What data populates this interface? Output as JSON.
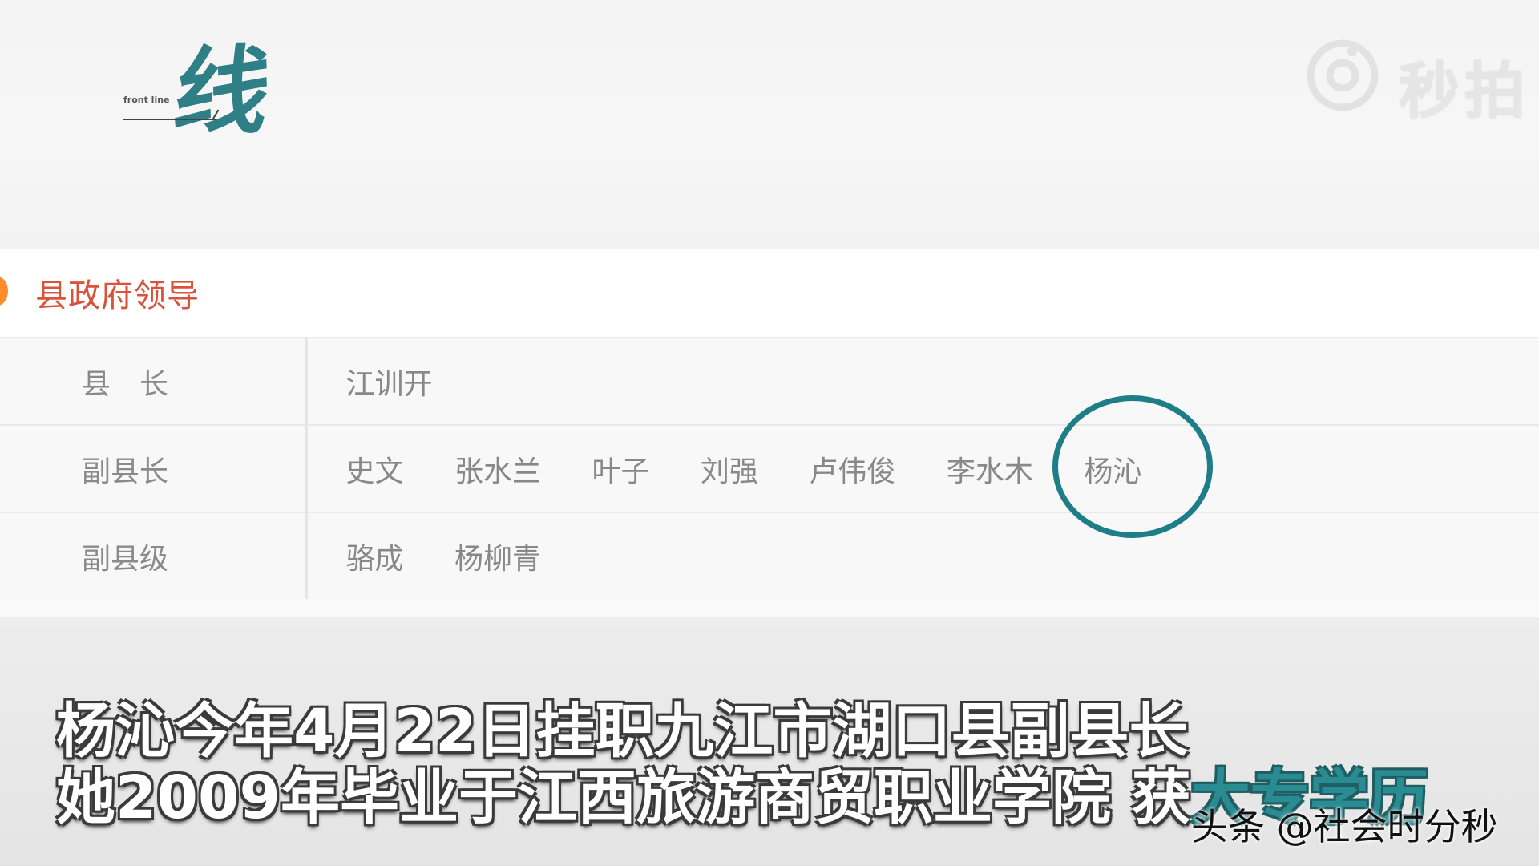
{
  "logo": {
    "main_char": "线",
    "subtext": "front line"
  },
  "watermark": {
    "text": "秒拍",
    "icon": "eye-camera-icon"
  },
  "section": {
    "title": "县政府领导",
    "marker_color": "#ff8c2a",
    "title_color": "#d9533a"
  },
  "leaders": {
    "rows": [
      {
        "role": "县　长",
        "names": [
          "江训开"
        ]
      },
      {
        "role": "副县长",
        "names": [
          "史文",
          "张水兰",
          "叶子",
          "刘强",
          "卢伟俊",
          "李水木",
          "杨沁"
        ]
      },
      {
        "role": "副县级",
        "names": [
          "骆成",
          "杨柳青"
        ]
      }
    ],
    "highlighted_name": "杨沁",
    "highlight_color": "#1e7e88"
  },
  "caption": {
    "line1": "杨沁今年4月22日挂职九江市湖口县副县长",
    "line2_main": "她2009年毕业于江西旅游商贸职业学院 获",
    "line2_highlight": "大专学历"
  },
  "source": {
    "text": "头条 @社会时分秒"
  }
}
